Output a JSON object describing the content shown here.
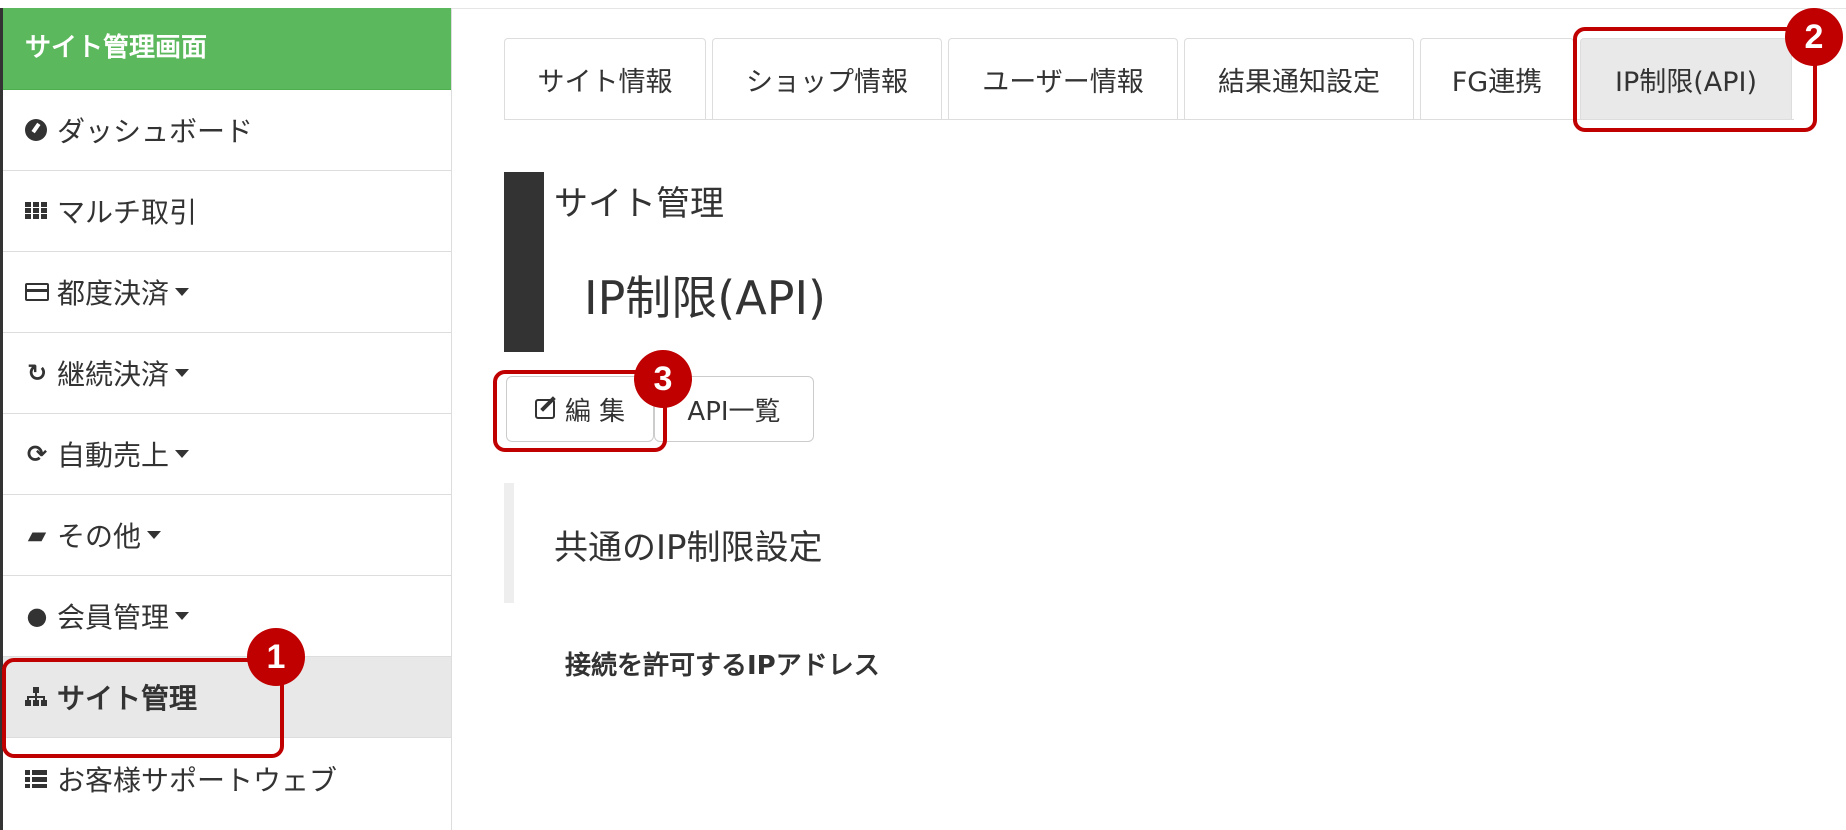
{
  "sidebar": {
    "title": "サイト管理画面",
    "items": [
      {
        "label": "ダッシュボード",
        "icon": "dashboard-icon"
      },
      {
        "label": "マルチ取引",
        "icon": "grid-icon"
      },
      {
        "label": "都度決済",
        "icon": "credit-card-icon"
      },
      {
        "label": "継続決済",
        "icon": "repeat-icon"
      },
      {
        "label": "自動売上",
        "icon": "refresh-icon"
      },
      {
        "label": "その他",
        "icon": "folder-open-icon"
      },
      {
        "label": "会員管理",
        "icon": "users-icon"
      },
      {
        "label": "サイト管理",
        "icon": "sitemap-icon"
      },
      {
        "label": "お客様サポートウェブ",
        "icon": "list-icon"
      }
    ]
  },
  "tabs": [
    {
      "label": "サイト情報"
    },
    {
      "label": "ショップ情報"
    },
    {
      "label": "ユーザー情報"
    },
    {
      "label": "結果通知設定"
    },
    {
      "label": "FG連携"
    },
    {
      "label": "IP制限(API)"
    }
  ],
  "heading": {
    "section": "サイト管理",
    "page": "IP制限(API)"
  },
  "buttons": {
    "edit": "編 集",
    "api_list": "API一覧"
  },
  "section": {
    "title": "共通のIP制限設定",
    "field_label": "接続を許可するIPアドレス"
  },
  "callouts": [
    "1",
    "2",
    "3"
  ],
  "colors": {
    "sidebar_header": "#5cb85c",
    "highlight": "#c00000",
    "heading_bar": "#333333"
  }
}
